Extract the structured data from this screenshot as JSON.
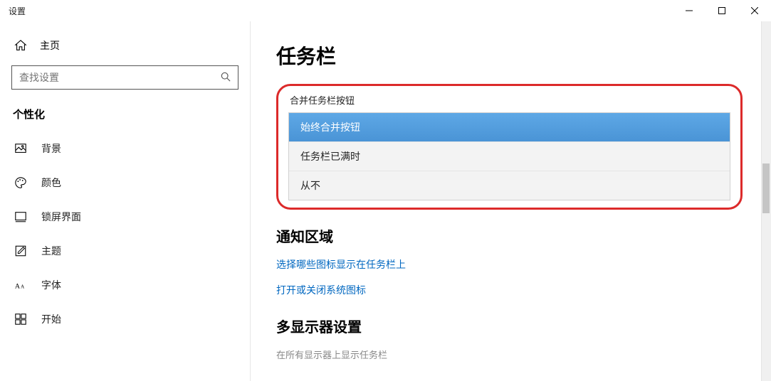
{
  "titlebar": {
    "app_name": "设置"
  },
  "sidebar": {
    "home_label": "主页",
    "search_placeholder": "查找设置",
    "section_label": "个性化",
    "items": [
      {
        "label": "背景"
      },
      {
        "label": "颜色"
      },
      {
        "label": "锁屏界面"
      },
      {
        "label": "主题"
      },
      {
        "label": "字体"
      },
      {
        "label": "开始"
      }
    ]
  },
  "main": {
    "title": "任务栏",
    "combine_label": "合并任务栏按钮",
    "combine_options": [
      "始终合并按钮",
      "任务栏已满时",
      "从不"
    ],
    "notification_heading": "通知区域",
    "link_select_icons": "选择哪些图标显示在任务栏上",
    "link_system_icons": "打开或关闭系统图标",
    "multi_monitor_heading": "多显示器设置",
    "multi_monitor_hint": "在所有显示器上显示任务栏"
  }
}
